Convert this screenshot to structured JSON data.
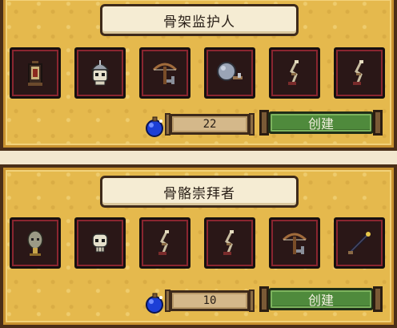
{
  "recipes": [
    {
      "title": "骨架监护人",
      "slots": [
        "lantern-icon",
        "helmeted-skull-icon",
        "crossbow-icon",
        "stone-hammer-icon",
        "bone-leg-icon",
        "bone-leg-icon"
      ],
      "count": "22",
      "create_label": "创建"
    },
    {
      "title": "骨骼崇拜者",
      "slots": [
        "hooded-idol-icon",
        "skull-icon",
        "bone-leg-icon",
        "bone-leg-icon",
        "crossbow-icon",
        "magic-staff-icon"
      ],
      "count": "10",
      "create_label": "创建"
    }
  ],
  "colors": {
    "panel": "#e5b94d",
    "slot_border": "#8a2530",
    "button": "#4f8a3c",
    "mana": "#1c3fd6"
  }
}
